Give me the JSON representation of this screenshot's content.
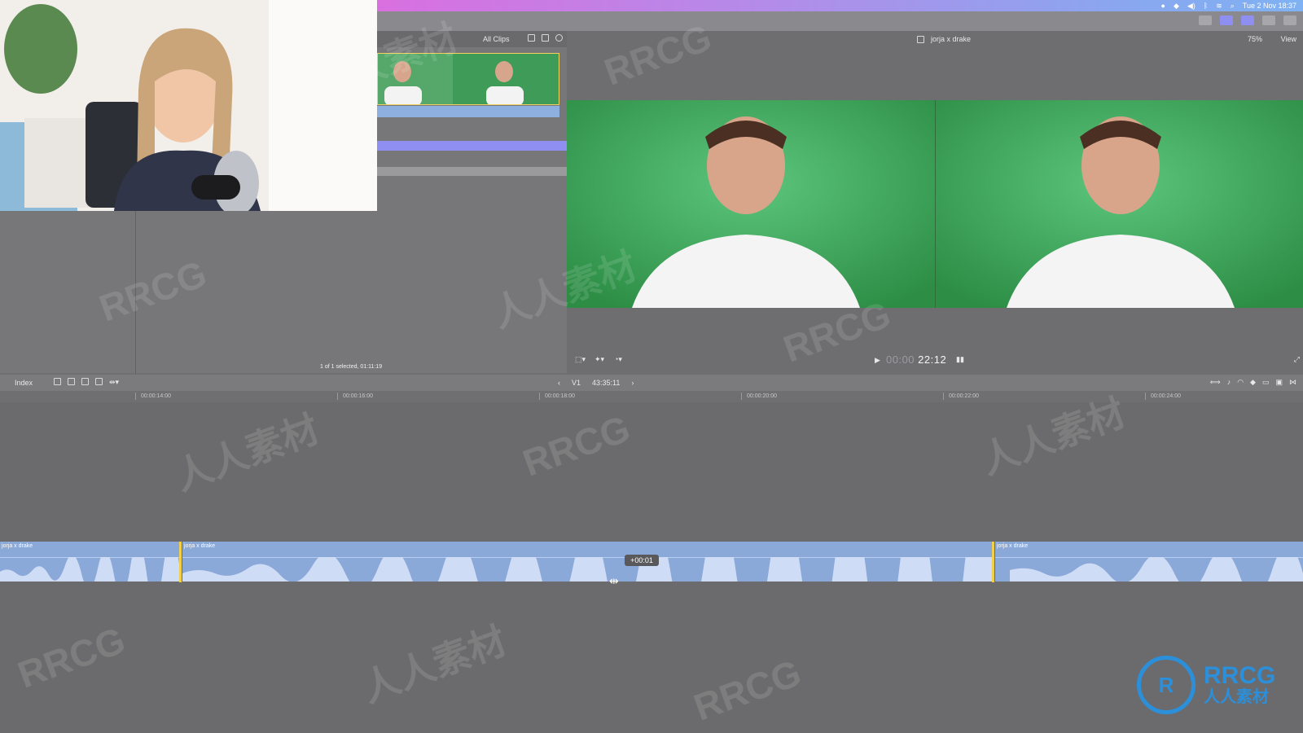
{
  "menubar": {
    "date_time": "Tue 2 Nov 18:37"
  },
  "browser": {
    "filter": "All Clips",
    "selection_info": "1 of 1 selected, 01:11:19"
  },
  "viewer": {
    "clip_title": "jorja x drake",
    "zoom": "75%",
    "view_menu": "View",
    "timecode_dim": "00:00",
    "timecode": "22:12"
  },
  "timeline": {
    "index_label": "Index",
    "track": "V1",
    "duration": "43:35:11",
    "ruler_ticks": [
      "00:00:14:00",
      "00:00:16:00",
      "00:00:18:00",
      "00:00:20:00",
      "00:00:22:00",
      "00:00:24:00"
    ],
    "clips": [
      {
        "name": "jorja x drake"
      },
      {
        "name": "jorja x drake"
      },
      {
        "name": "jorja x drake"
      }
    ],
    "trim_offset": "+00:01"
  },
  "watermark": {
    "logo_big": "RRCG",
    "logo_small": "人人素材",
    "logo_mark": "R",
    "repeats": [
      "RRCG",
      "人人素材"
    ]
  },
  "colors": {
    "accent": "#8e8ff0",
    "clip_blue": "#8aa8d8",
    "edit_point": "#f2cf4b",
    "green_screen": "#3da559"
  }
}
